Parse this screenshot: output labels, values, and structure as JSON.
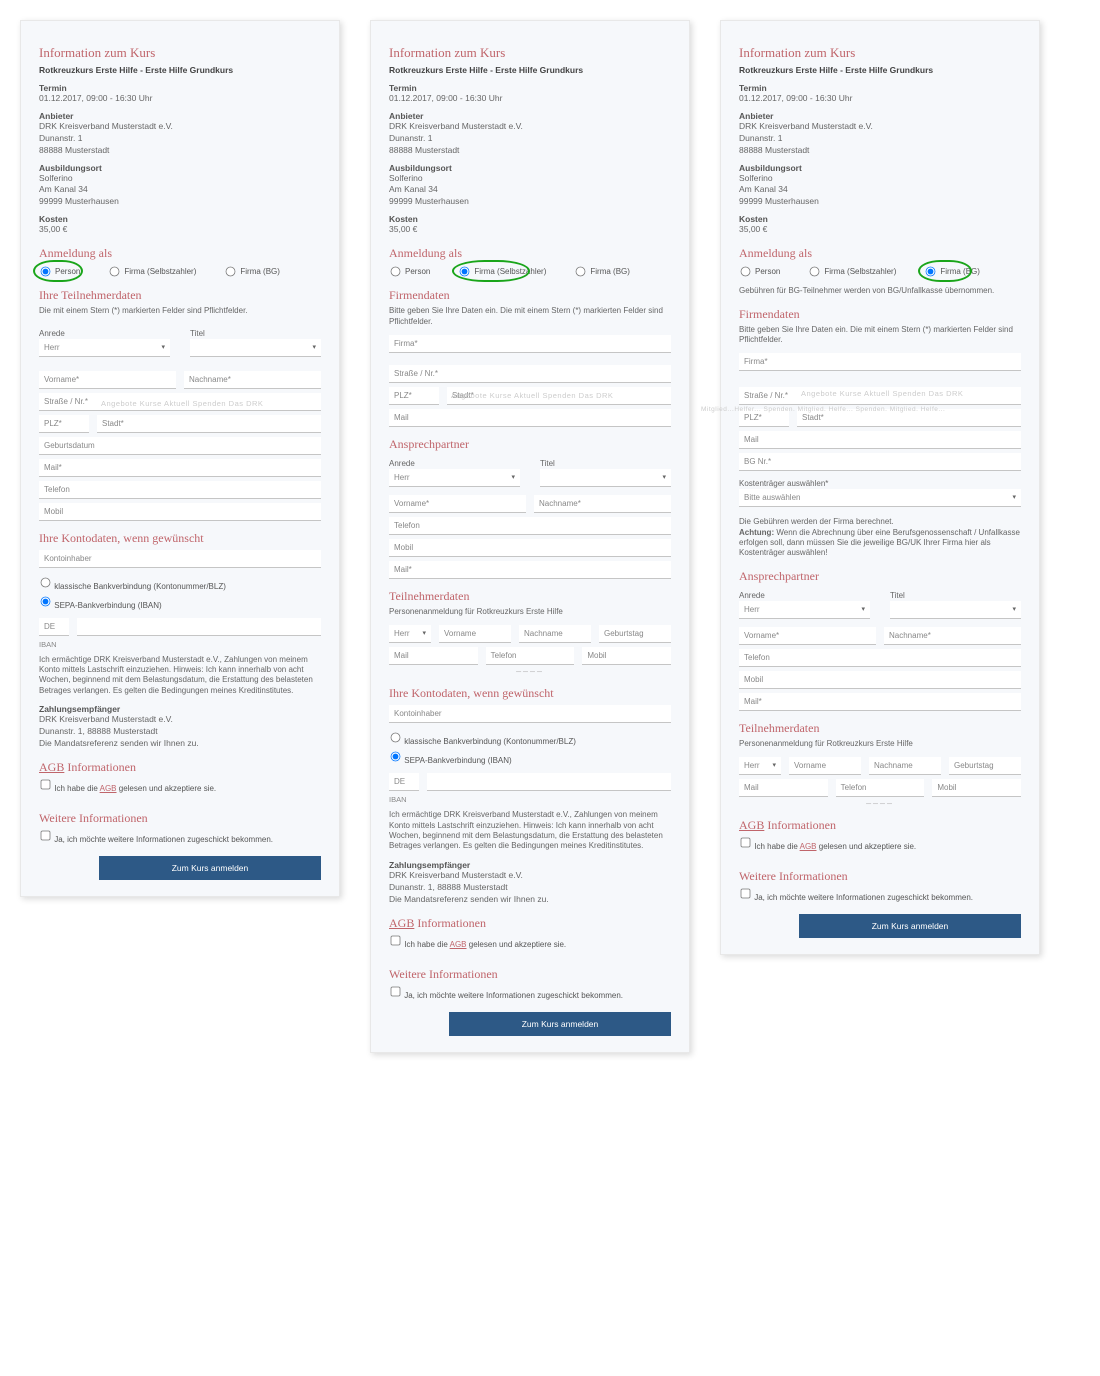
{
  "info": {
    "heading": "Information zum Kurs",
    "subtitle": "Rotkreuzkurs Erste Hilfe - Erste Hilfe Grundkurs",
    "termin_label": "Termin",
    "termin_value": "01.12.2017, 09:00 - 16:30 Uhr",
    "anbieter_label": "Anbieter",
    "anbieter_lines": "DRK Kreisverband Musterstadt e.V.\nDunanstr. 1\n88888 Musterstadt",
    "ort_label": "Ausbildungsort",
    "ort_lines": "Solferino\nAm Kanal 34\n99999 Musterhausen",
    "kosten_label": "Kosten",
    "kosten_value": "35,00 €",
    "anmeldung_als": "Anmeldung als",
    "opt_person": "Person",
    "opt_selbst": "Firma (Selbstzahler)",
    "opt_bg": "Firma (BG)"
  },
  "nav_ghost": "Angebote   Kurse   Aktuell   Spenden   Das DRK",
  "nav_ghost2": "Mitglied...Helfer...          Spenden. Mitglied. Helfe...          Spenden. Mitglied. Helfe...",
  "teilnehmer": {
    "heading": "Ihre Teilnehmerdaten",
    "desc": "Die mit einem Stern (*) markierten Felder sind Pflichtfelder.",
    "anrede": "Anrede",
    "titel": "Titel",
    "herr": "Herr",
    "vorname": "Vorname*",
    "nachname": "Nachname*",
    "strasse": "Straße / Nr.*",
    "plz": "PLZ*",
    "stadt": "Stadt*",
    "geburt": "Geburtsdatum",
    "mail": "Mail*",
    "telefon": "Telefon",
    "mobil": "Mobil"
  },
  "firmendaten": {
    "heading": "Firmendaten",
    "desc": "Bitte geben Sie Ihre Daten ein. Die mit einem Stern (*) markierten Felder sind Pflichtfelder.",
    "firma": "Firma*",
    "strasse": "Straße / Nr.*",
    "plz": "PLZ*",
    "stadt": "Stadt*",
    "mail": "Mail",
    "bgnr": "BG Nr.*",
    "kost_label": "Kostenträger auswählen*",
    "kost_placeholder": "Bitte auswählen",
    "kost_note": "Die Gebühren werden der Firma berechnet.",
    "kost_warn_bold": "Achtung:",
    "kost_warn": " Wenn die Abrechnung über eine Berufsgenossenschaft / Unfallkasse erfolgen soll, dann müssen Sie die jeweilige BG/UK Ihrer Firma hier als Kostenträger auswählen!"
  },
  "bg_note": "Gebühren für BG-Teilnehmer werden von BG/Unfallkasse übernommen.",
  "ansprech": {
    "heading": "Ansprechpartner",
    "anrede": "Anrede",
    "titel": "Titel",
    "herr": "Herr",
    "vorname": "Vorname*",
    "nachname": "Nachname*",
    "telefon": "Telefon",
    "mobil": "Mobil",
    "mail": "Mail*"
  },
  "teil_list": {
    "heading": "Teilnehmerdaten",
    "desc": "Personenanmeldung für Rotkreuzkurs Erste Hilfe",
    "herr": "Herr",
    "vorname": "Vorname",
    "nachname": "Nachname",
    "geburt": "Geburtstag",
    "mail": "Mail",
    "telefon": "Telefon",
    "mobil": "Mobil"
  },
  "konto": {
    "heading": "Ihre Kontodaten, wenn gewünscht",
    "inhaber": "Kontoinhaber",
    "klassisch": "klassische Bankverbindung (Kontonummer/BLZ)",
    "sepa": "SEPA-Bankverbindung (IBAN)",
    "de": "DE",
    "iban": "IBAN",
    "mandat": "Ich ermächtige DRK Kreisverband Musterstadt e.V., Zahlungen von meinem Konto mittels Lastschrift einzuziehen. Hinweis: Ich kann innerhalb von acht Wochen, beginnend mit dem Belastungsdatum, die Erstattung des belasteten Betrages verlangen. Es gelten die Bedingungen meines Kreditinstitutes.",
    "empf_label": "Zahlungsempfänger",
    "empf_lines": "DRK Kreisverband Musterstadt e.V.\nDunanstr. 1, 88888 Musterstadt\nDie Mandatsreferenz senden wir Ihnen zu."
  },
  "agb": {
    "heading_pre": "AGB",
    "heading_post": " Informationen",
    "check": "Ich habe die ",
    "check_link": "AGB",
    "check_post": " gelesen und akzeptiere sie."
  },
  "weitere": {
    "heading": "Weitere Informationen",
    "check": "Ja, ich möchte weitere Informationen zugeschickt bekommen."
  },
  "submit": "Zum Kurs anmelden"
}
